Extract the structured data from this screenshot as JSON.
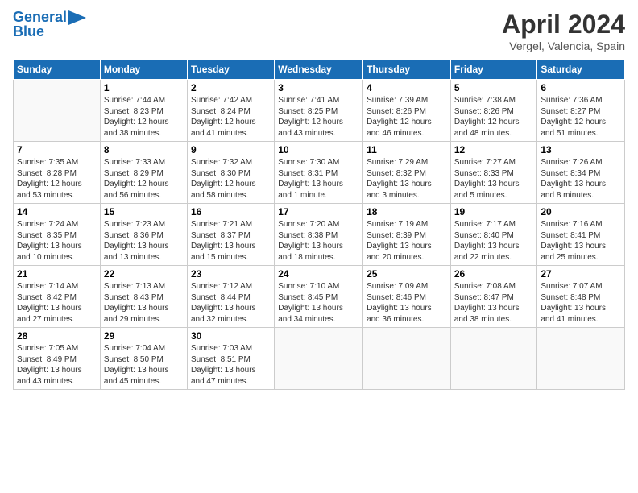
{
  "header": {
    "logo_line1": "General",
    "logo_line2": "Blue",
    "main_title": "April 2024",
    "subtitle": "Vergel, Valencia, Spain"
  },
  "weekdays": [
    "Sunday",
    "Monday",
    "Tuesday",
    "Wednesday",
    "Thursday",
    "Friday",
    "Saturday"
  ],
  "weeks": [
    [
      {
        "day": "",
        "info": ""
      },
      {
        "day": "1",
        "info": "Sunrise: 7:44 AM\nSunset: 8:23 PM\nDaylight: 12 hours\nand 38 minutes."
      },
      {
        "day": "2",
        "info": "Sunrise: 7:42 AM\nSunset: 8:24 PM\nDaylight: 12 hours\nand 41 minutes."
      },
      {
        "day": "3",
        "info": "Sunrise: 7:41 AM\nSunset: 8:25 PM\nDaylight: 12 hours\nand 43 minutes."
      },
      {
        "day": "4",
        "info": "Sunrise: 7:39 AM\nSunset: 8:26 PM\nDaylight: 12 hours\nand 46 minutes."
      },
      {
        "day": "5",
        "info": "Sunrise: 7:38 AM\nSunset: 8:26 PM\nDaylight: 12 hours\nand 48 minutes."
      },
      {
        "day": "6",
        "info": "Sunrise: 7:36 AM\nSunset: 8:27 PM\nDaylight: 12 hours\nand 51 minutes."
      }
    ],
    [
      {
        "day": "7",
        "info": "Sunrise: 7:35 AM\nSunset: 8:28 PM\nDaylight: 12 hours\nand 53 minutes."
      },
      {
        "day": "8",
        "info": "Sunrise: 7:33 AM\nSunset: 8:29 PM\nDaylight: 12 hours\nand 56 minutes."
      },
      {
        "day": "9",
        "info": "Sunrise: 7:32 AM\nSunset: 8:30 PM\nDaylight: 12 hours\nand 58 minutes."
      },
      {
        "day": "10",
        "info": "Sunrise: 7:30 AM\nSunset: 8:31 PM\nDaylight: 13 hours\nand 1 minute."
      },
      {
        "day": "11",
        "info": "Sunrise: 7:29 AM\nSunset: 8:32 PM\nDaylight: 13 hours\nand 3 minutes."
      },
      {
        "day": "12",
        "info": "Sunrise: 7:27 AM\nSunset: 8:33 PM\nDaylight: 13 hours\nand 5 minutes."
      },
      {
        "day": "13",
        "info": "Sunrise: 7:26 AM\nSunset: 8:34 PM\nDaylight: 13 hours\nand 8 minutes."
      }
    ],
    [
      {
        "day": "14",
        "info": "Sunrise: 7:24 AM\nSunset: 8:35 PM\nDaylight: 13 hours\nand 10 minutes."
      },
      {
        "day": "15",
        "info": "Sunrise: 7:23 AM\nSunset: 8:36 PM\nDaylight: 13 hours\nand 13 minutes."
      },
      {
        "day": "16",
        "info": "Sunrise: 7:21 AM\nSunset: 8:37 PM\nDaylight: 13 hours\nand 15 minutes."
      },
      {
        "day": "17",
        "info": "Sunrise: 7:20 AM\nSunset: 8:38 PM\nDaylight: 13 hours\nand 18 minutes."
      },
      {
        "day": "18",
        "info": "Sunrise: 7:19 AM\nSunset: 8:39 PM\nDaylight: 13 hours\nand 20 minutes."
      },
      {
        "day": "19",
        "info": "Sunrise: 7:17 AM\nSunset: 8:40 PM\nDaylight: 13 hours\nand 22 minutes."
      },
      {
        "day": "20",
        "info": "Sunrise: 7:16 AM\nSunset: 8:41 PM\nDaylight: 13 hours\nand 25 minutes."
      }
    ],
    [
      {
        "day": "21",
        "info": "Sunrise: 7:14 AM\nSunset: 8:42 PM\nDaylight: 13 hours\nand 27 minutes."
      },
      {
        "day": "22",
        "info": "Sunrise: 7:13 AM\nSunset: 8:43 PM\nDaylight: 13 hours\nand 29 minutes."
      },
      {
        "day": "23",
        "info": "Sunrise: 7:12 AM\nSunset: 8:44 PM\nDaylight: 13 hours\nand 32 minutes."
      },
      {
        "day": "24",
        "info": "Sunrise: 7:10 AM\nSunset: 8:45 PM\nDaylight: 13 hours\nand 34 minutes."
      },
      {
        "day": "25",
        "info": "Sunrise: 7:09 AM\nSunset: 8:46 PM\nDaylight: 13 hours\nand 36 minutes."
      },
      {
        "day": "26",
        "info": "Sunrise: 7:08 AM\nSunset: 8:47 PM\nDaylight: 13 hours\nand 38 minutes."
      },
      {
        "day": "27",
        "info": "Sunrise: 7:07 AM\nSunset: 8:48 PM\nDaylight: 13 hours\nand 41 minutes."
      }
    ],
    [
      {
        "day": "28",
        "info": "Sunrise: 7:05 AM\nSunset: 8:49 PM\nDaylight: 13 hours\nand 43 minutes."
      },
      {
        "day": "29",
        "info": "Sunrise: 7:04 AM\nSunset: 8:50 PM\nDaylight: 13 hours\nand 45 minutes."
      },
      {
        "day": "30",
        "info": "Sunrise: 7:03 AM\nSunset: 8:51 PM\nDaylight: 13 hours\nand 47 minutes."
      },
      {
        "day": "",
        "info": ""
      },
      {
        "day": "",
        "info": ""
      },
      {
        "day": "",
        "info": ""
      },
      {
        "day": "",
        "info": ""
      }
    ]
  ]
}
